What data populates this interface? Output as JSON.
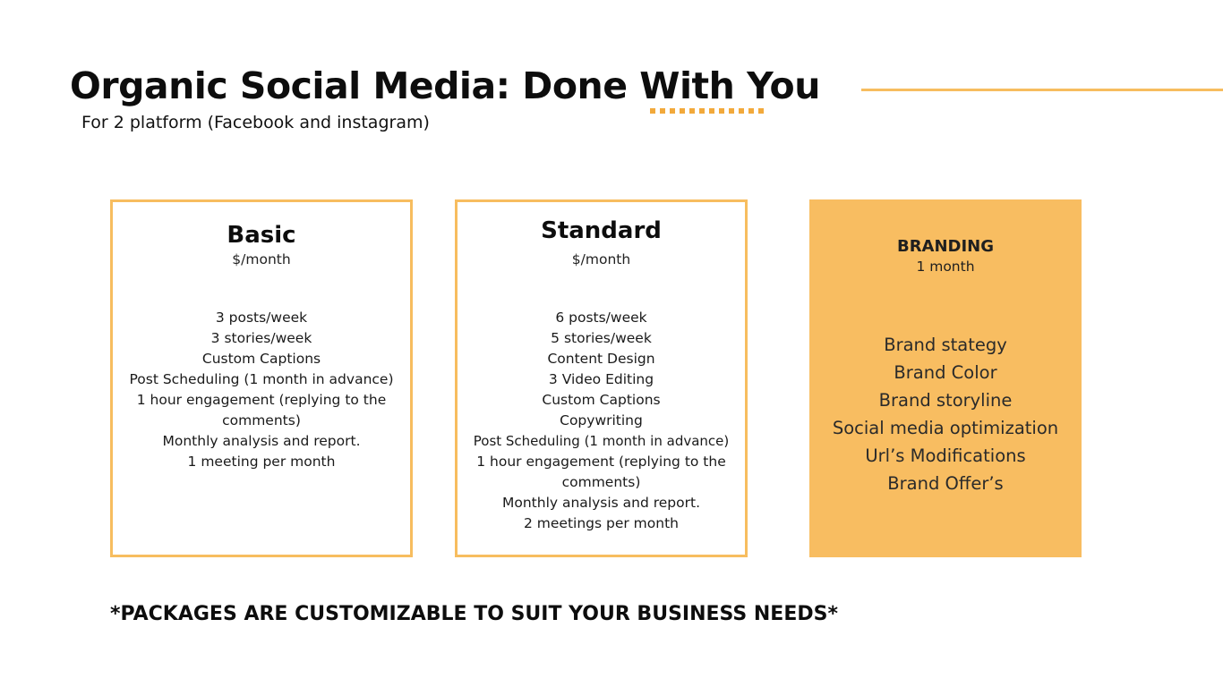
{
  "header": {
    "title": "Organic Social Media: Done With You",
    "subtitle": "For 2 platform (Facebook and instagram)",
    "accent_color": "#f7bd5f"
  },
  "packages": [
    {
      "name": "Basic",
      "price": "$/month",
      "features": [
        "3 posts/week",
        "3 stories/week",
        "Custom Captions",
        "Post Scheduling (1 month in advance)",
        "1 hour engagement (replying to the comments)",
        "Monthly analysis and report.",
        "1 meeting per month"
      ]
    },
    {
      "name": "Standard",
      "price": "$/month",
      "features": [
        "6 posts/week",
        "5 stories/week",
        "Content Design",
        "3 Video Editing",
        "Custom Captions",
        "Copywriting",
        "Post Scheduling (1 month in advance)",
        "1 hour engagement (replying to the comments)",
        "Monthly analysis and report.",
        "2 meetings per month"
      ]
    },
    {
      "name": "BRANDING",
      "price": "1 month",
      "fill_color": "#f8bd61",
      "features": [
        "Brand stategy",
        "Brand Color",
        "Brand storyline",
        "Social media optimization",
        "Url’s Modifications",
        "Brand Offer’s"
      ]
    }
  ],
  "footer": {
    "note": "*PACKAGES ARE CUSTOMIZABLE TO SUIT YOUR BUSINESS NEEDS*"
  }
}
